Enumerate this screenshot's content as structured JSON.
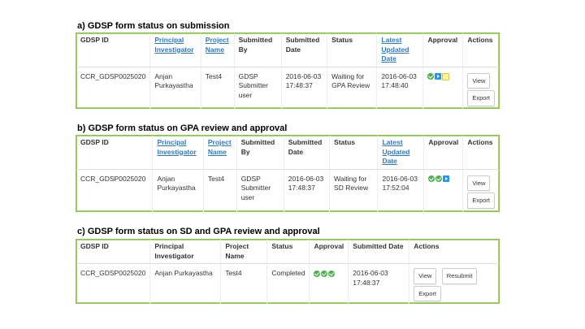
{
  "colors": {
    "panel_border": "#8bc34a",
    "link": "#2e78c2",
    "approved": "#4caf50",
    "forwarded": "#2196f3",
    "pending": "#fff59d"
  },
  "sections": [
    {
      "title": "a) GDSP form status on submission",
      "headers": [
        "GDSP ID",
        "Principal Investigator",
        "Project Name",
        "Submitted By",
        "Submitted Date",
        "Status",
        "Latest Updated Date",
        "Approval",
        "Actions"
      ],
      "row": {
        "gdsp_id": "CCR_GDSP0025020",
        "pi": "Anjan Purkayastha",
        "project": "Test4",
        "submitted_by": "GDSP Submitter user",
        "submitted_date": "2016-06-03 17:48:37",
        "status": "Waiting for GPA Review",
        "latest_date": "2016-06-03 17:48:40",
        "approval_icons": [
          "check-circle-icon",
          "forward-icon",
          "pending-icon"
        ],
        "actions": [
          "View",
          "Export"
        ]
      }
    },
    {
      "title": "b) GDSP form status on GPA review and approval",
      "headers": [
        "GDSP ID",
        "Principal Investigator",
        "Project Name",
        "Submitted By",
        "Submitted Date",
        "Status",
        "Latest Updated Date",
        "Approval",
        "Actions"
      ],
      "row": {
        "gdsp_id": "CCR_GDSP0025020",
        "pi": "Anjan Purkayastha",
        "project": "Test4",
        "submitted_by": "GDSP Submitter user",
        "submitted_date": "2016-06-03 17:48:37",
        "status": "Waiting for SD Review",
        "latest_date": "2016-06-03 17:52:04",
        "approval_icons": [
          "check-circle-icon",
          "check-circle-icon",
          "forward-icon"
        ],
        "actions": [
          "View",
          "Export"
        ]
      }
    },
    {
      "title": "c) GDSP form status on SD and GPA review and approval",
      "headers": [
        "GDSP ID",
        "Principal Investigator",
        "Project Name",
        "Status",
        "Approval",
        "Submitted Date",
        "Actions"
      ],
      "row": {
        "gdsp_id": "CCR_GDSP0025020",
        "pi": "Anjan Purkayastha",
        "project": "Test4",
        "status": "Completed",
        "approval_icons": [
          "check-circle-icon",
          "check-circle-icon",
          "check-circle-icon"
        ],
        "submitted_date": "2016-06-03 17:48:37",
        "actions": [
          "View",
          "Resubmit",
          "Export"
        ]
      }
    }
  ]
}
